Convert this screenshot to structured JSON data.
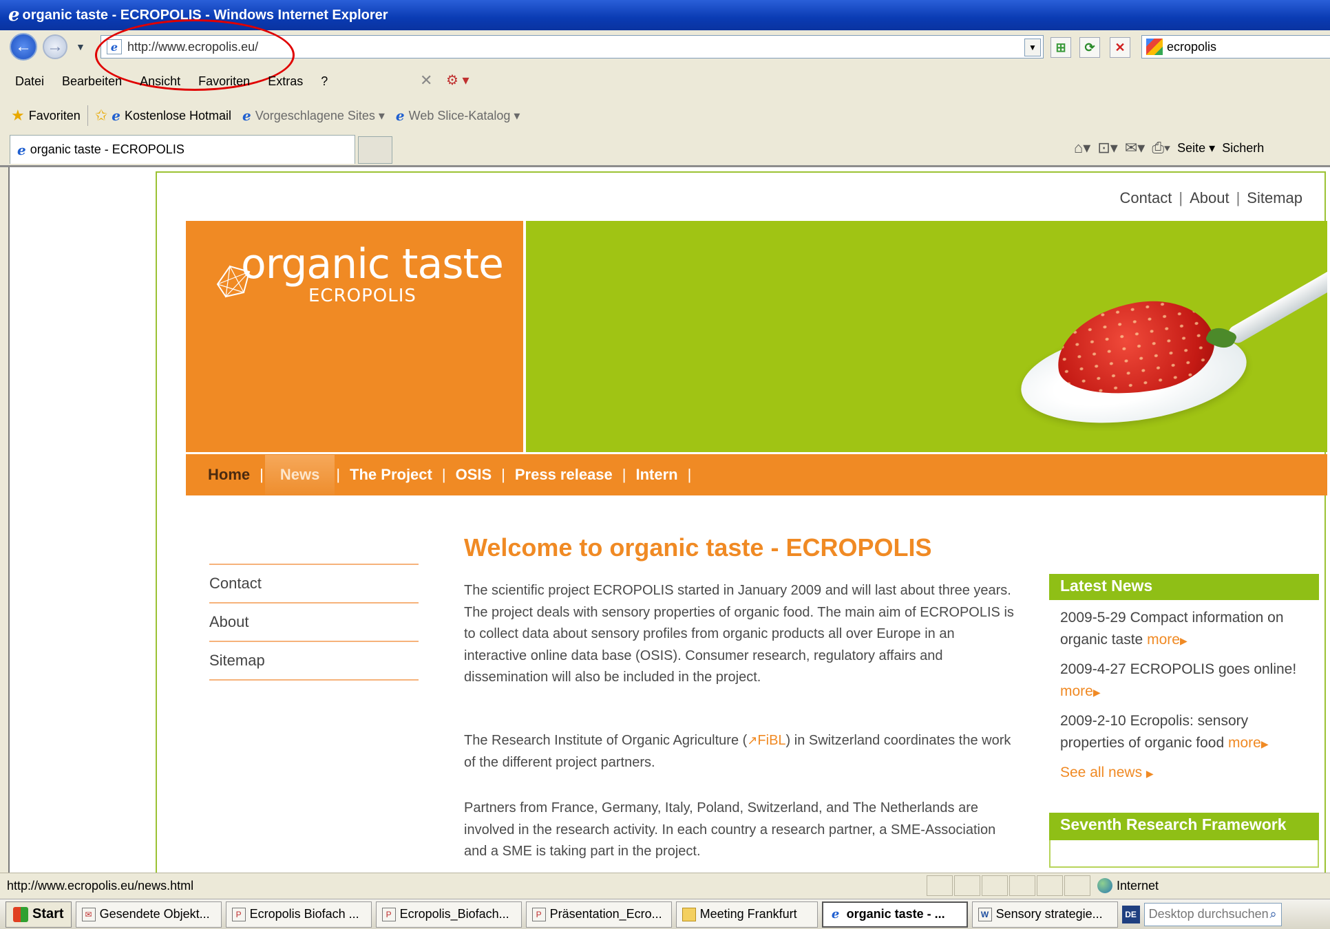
{
  "window": {
    "title": "organic taste - ECROPOLIS - Windows Internet Explorer"
  },
  "address": {
    "url": "http://www.ecropolis.eu/"
  },
  "search": {
    "value": "ecropolis"
  },
  "menu": {
    "items": [
      "Datei",
      "Bearbeiten",
      "Ansicht",
      "Favoriten",
      "Extras",
      "?"
    ]
  },
  "favorites": {
    "label": "Favoriten",
    "items": [
      "Kostenlose Hotmail",
      "Vorgeschlagene Sites ▾",
      "Web Slice-Katalog ▾"
    ]
  },
  "tab": {
    "title": "organic taste - ECROPOLIS"
  },
  "commandbar": {
    "page": "Seite ▾",
    "safety": "Sicherh"
  },
  "site": {
    "toplinks": [
      "Contact",
      "About",
      "Sitemap"
    ],
    "logo": {
      "title": "organic taste",
      "subtitle": "ECROPOLIS"
    },
    "nav": [
      "Home",
      "News",
      "The Project",
      "OSIS",
      "Press release",
      "Intern"
    ],
    "leftnav": [
      "Contact",
      "About",
      "Sitemap"
    ],
    "heading": "Welcome to organic taste - ECROPOLIS",
    "p1": "The scientific project ECROPOLIS started in January 2009 and will last about three years. The project deals with sensory properties of organic food. The main aim of ECROPOLIS is to collect data about sensory profiles from organic products all over Europe in an interactive online data base (OSIS). Consumer research, regulatory affairs and dissemination will also be included in the project.",
    "p2_before": "The Research Institute of Organic Agriculture (",
    "p2_link": "FiBL",
    "p2_after": ") in Switzerland coordinates the work of the different project partners.",
    "p3": "Partners from France, Germany, Italy, Poland, Switzerland, and The Netherlands are involved in the research activity. In each country a research partner, a SME-Association and a SME is taking part in the project.",
    "news": {
      "heading": "Latest News",
      "items": [
        {
          "text": "2009-5-29 Compact information on organic taste",
          "more": "more"
        },
        {
          "text": "2009-4-27 ECROPOLIS goes online!",
          "more": "more"
        },
        {
          "text": "2009-2-10 Ecropolis: sensory properties of organic food",
          "more": "more"
        }
      ],
      "see_all": "See all news"
    },
    "framework": {
      "heading": "Seventh Research Framework"
    }
  },
  "status": {
    "url": "http://www.ecropolis.eu/news.html",
    "zone": "Internet"
  },
  "taskbar": {
    "start": "Start",
    "items": [
      "Gesendete Objekt...",
      "Ecropolis Biofach ...",
      "Ecropolis_Biofach...",
      "Präsentation_Ecro...",
      "Meeting Frankfurt",
      "organic taste - ...",
      "Sensory strategie..."
    ],
    "lang": "DE",
    "search_placeholder": "Desktop durchsuchen"
  },
  "colors": {
    "orange": "#f08a24",
    "green": "#a0c414",
    "title_blue": "#0a3bb3"
  }
}
